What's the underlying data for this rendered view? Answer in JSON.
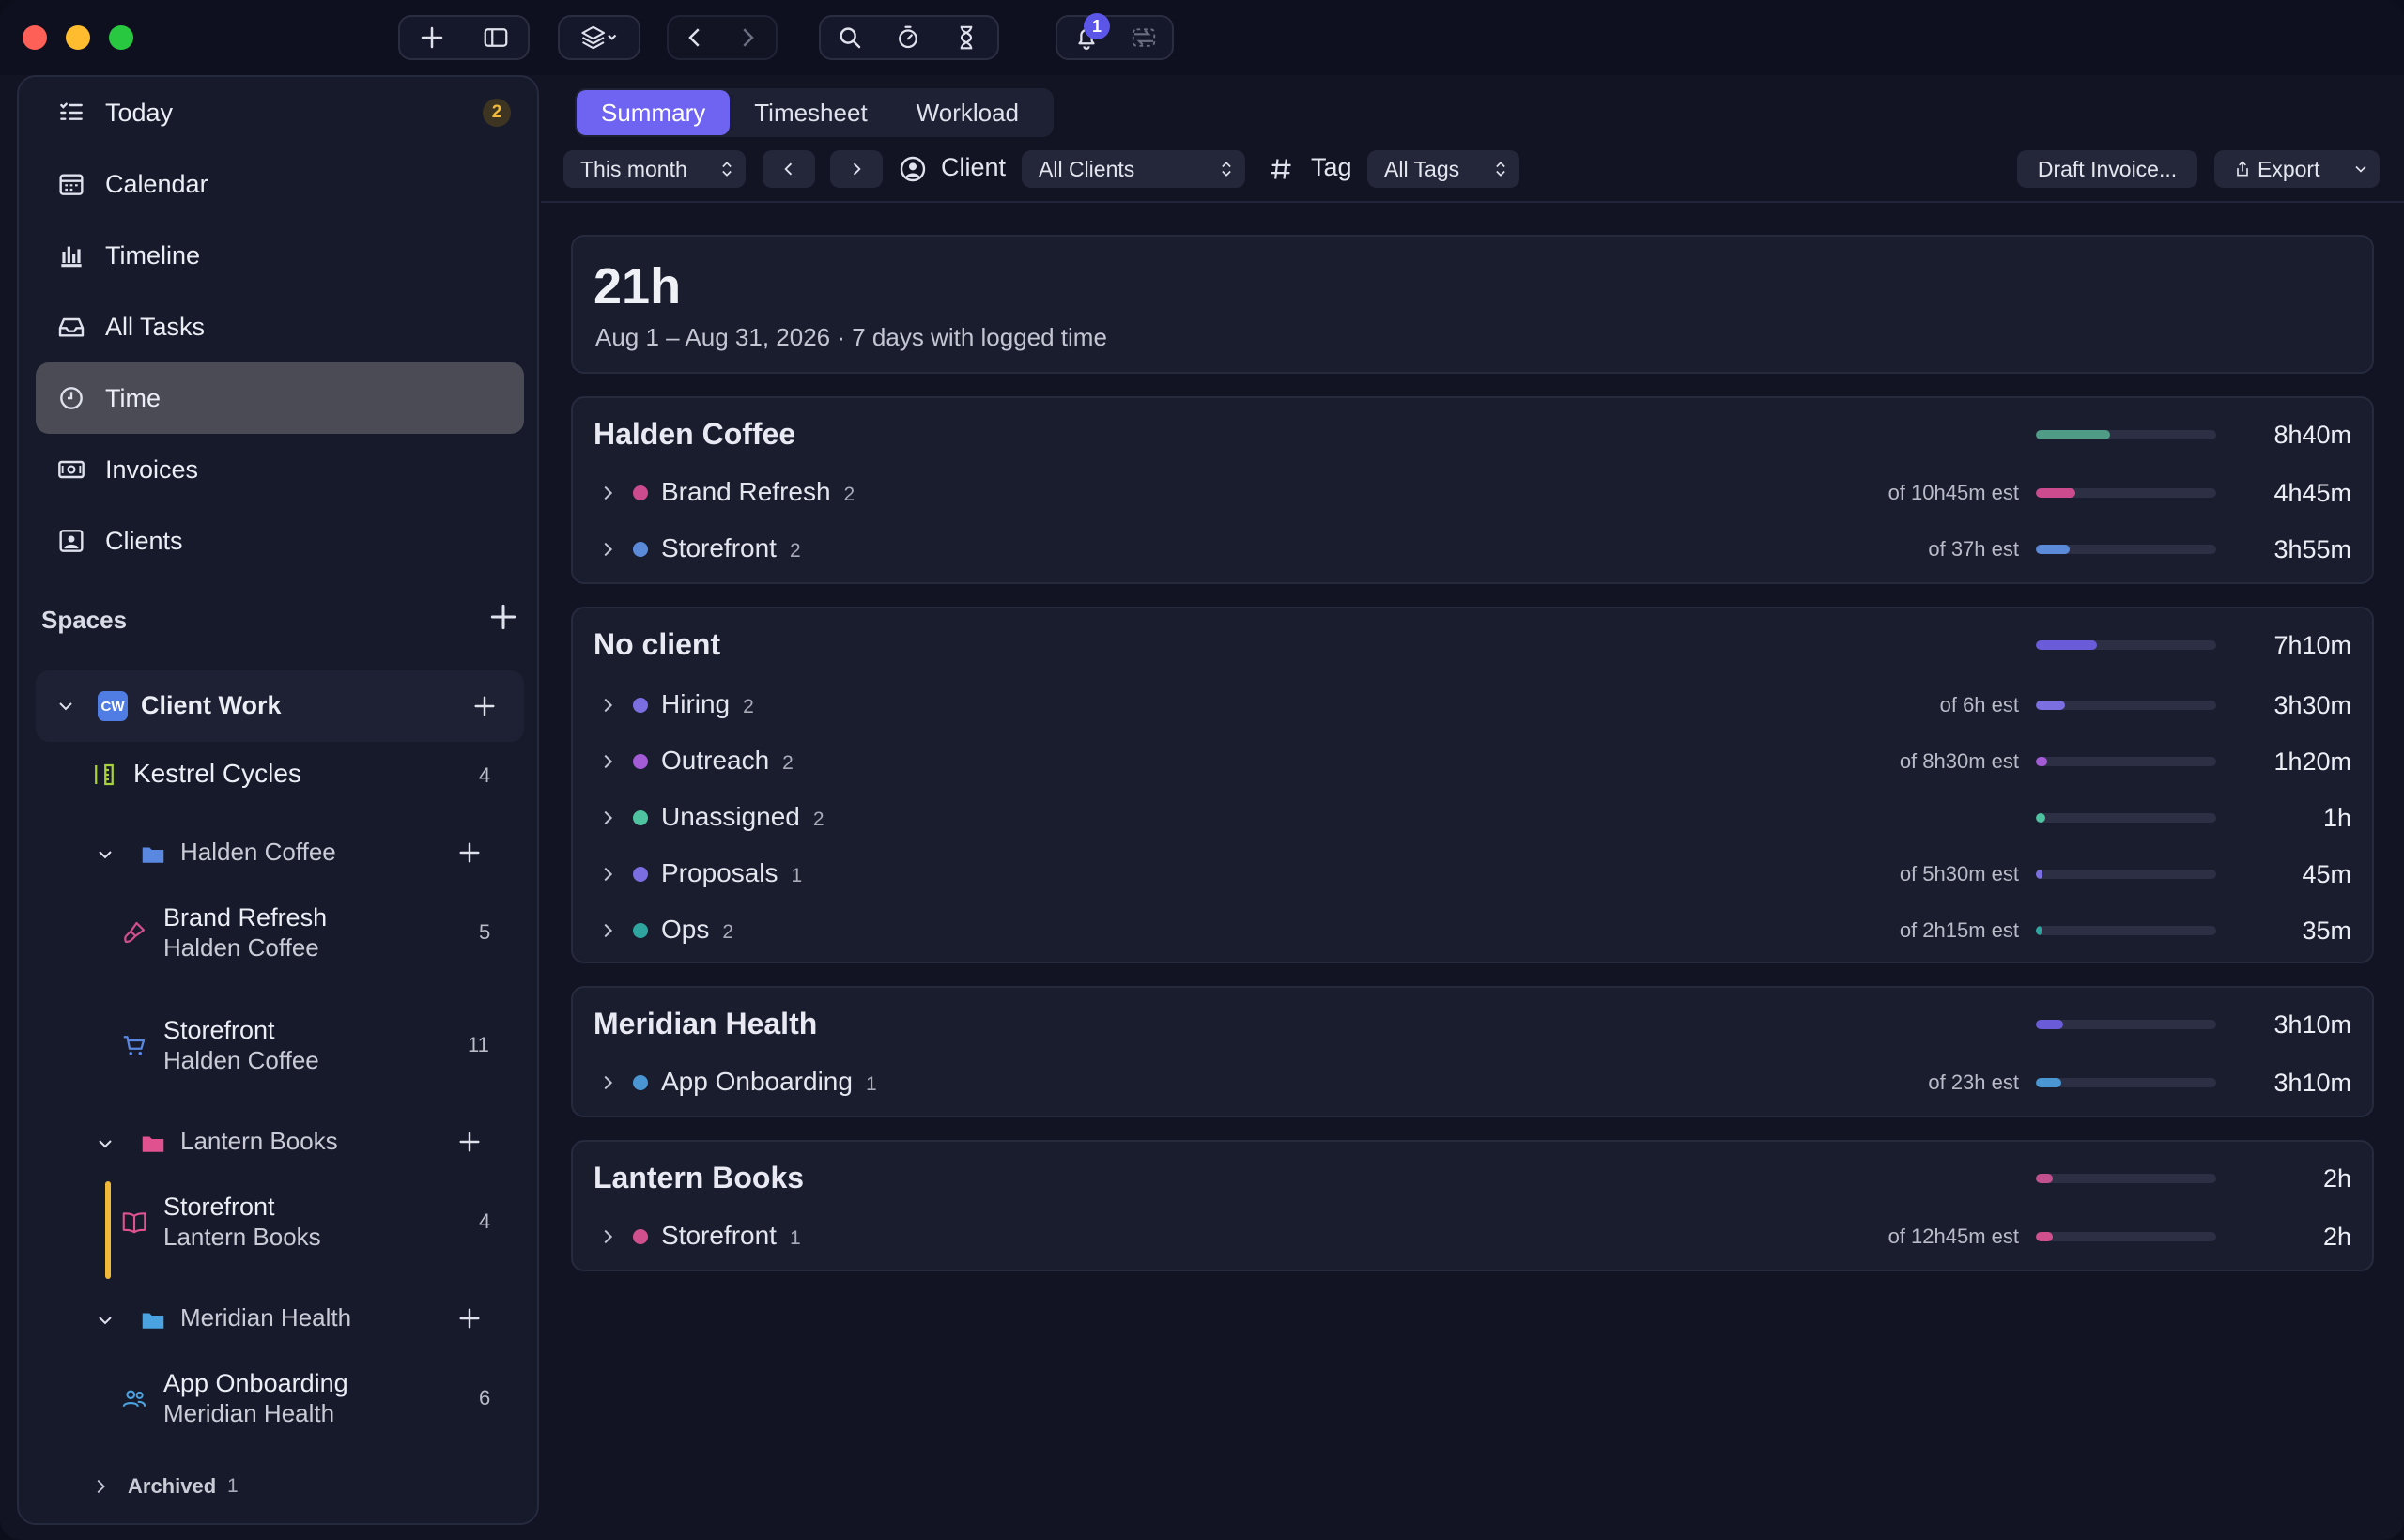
{
  "toolbar": {
    "notification_count": "1"
  },
  "sidebar": {
    "nav": [
      {
        "label": "Today",
        "icon": "today-list-icon",
        "badge": "2"
      },
      {
        "label": "Calendar",
        "icon": "calendar-icon"
      },
      {
        "label": "Timeline",
        "icon": "timeline-bars-icon"
      },
      {
        "label": "All Tasks",
        "icon": "inbox-tray-icon"
      },
      {
        "label": "Time",
        "icon": "clock-icon",
        "active": true
      },
      {
        "label": "Invoices",
        "icon": "invoice-money-icon"
      },
      {
        "label": "Clients",
        "icon": "client-card-icon"
      }
    ],
    "spaces_label": "Spaces",
    "space": {
      "badge": "CW",
      "name": "Client Work"
    },
    "tree": {
      "kestrel": {
        "name": "Kestrel Cycles",
        "count": "4"
      },
      "halden": {
        "name": "Halden Coffee"
      },
      "brand_refresh": {
        "name": "Brand Refresh",
        "client": "Halden Coffee",
        "count": "5"
      },
      "storefront_hc": {
        "name": "Storefront",
        "client": "Halden Coffee",
        "count": "11"
      },
      "lantern": {
        "name": "Lantern Books"
      },
      "storefront_lb": {
        "name": "Storefront",
        "client": "Lantern Books",
        "count": "4"
      },
      "meridian": {
        "name": "Meridian Health"
      },
      "app_onboarding": {
        "name": "App Onboarding",
        "client": "Meridian Health",
        "count": "6"
      }
    },
    "archived": {
      "label": "Archived",
      "count": "1"
    }
  },
  "tabs": [
    {
      "label": "Summary",
      "active": true
    },
    {
      "label": "Timesheet"
    },
    {
      "label": "Workload"
    }
  ],
  "filters": {
    "period": "This month",
    "client_label": "Client",
    "client_value": "All Clients",
    "tag_label": "Tag",
    "tag_value": "All Tags",
    "draft_invoice": "Draft Invoice...",
    "export": "Export"
  },
  "summary": {
    "total": "21h",
    "subtitle": "Aug 1 – Aug 31, 2026 · 7 days with logged time"
  },
  "groups": [
    {
      "name": "Halden Coffee",
      "total": "8h40m",
      "fraction": 0.41,
      "color": "#4f9b86",
      "rows": [
        {
          "name": "Brand Refresh",
          "count": "2",
          "est": "of 10h45m est",
          "time": "4h45m",
          "fraction": 0.22,
          "color": "#cc4b8f"
        },
        {
          "name": "Storefront",
          "count": "2",
          "est": "of 37h est",
          "time": "3h55m",
          "fraction": 0.19,
          "color": "#5b8ad8"
        }
      ]
    },
    {
      "name": "No client",
      "total": "7h10m",
      "fraction": 0.34,
      "color": "#6a5cd8",
      "rows": [
        {
          "name": "Hiring",
          "count": "2",
          "est": "of 6h est",
          "time": "3h30m",
          "fraction": 0.16,
          "color": "#7b6ee0"
        },
        {
          "name": "Outreach",
          "count": "2",
          "est": "of 8h30m est",
          "time": "1h20m",
          "fraction": 0.06,
          "color": "#a35bd6"
        },
        {
          "name": "Unassigned",
          "count": "2",
          "est": "",
          "time": "1h",
          "fraction": 0.05,
          "color": "#4fc2a0"
        },
        {
          "name": "Proposals",
          "count": "1",
          "est": "of 5h30m est",
          "time": "45m",
          "fraction": 0.035,
          "color": "#7b6ee0"
        },
        {
          "name": "Ops",
          "count": "2",
          "est": "of 2h15m est",
          "time": "35m",
          "fraction": 0.03,
          "color": "#2fa5a0"
        }
      ]
    },
    {
      "name": "Meridian Health",
      "total": "3h10m",
      "fraction": 0.15,
      "color": "#6a5cd8",
      "rows": [
        {
          "name": "App Onboarding",
          "count": "1",
          "est": "of 23h est",
          "time": "3h10m",
          "fraction": 0.14,
          "color": "#4a96d2"
        }
      ]
    },
    {
      "name": "Lantern Books",
      "total": "2h",
      "fraction": 0.095,
      "color": "#c2508e",
      "rows": [
        {
          "name": "Storefront",
          "count": "1",
          "est": "of 12h45m est",
          "time": "2h",
          "fraction": 0.095,
          "color": "#d0508e"
        }
      ]
    }
  ]
}
